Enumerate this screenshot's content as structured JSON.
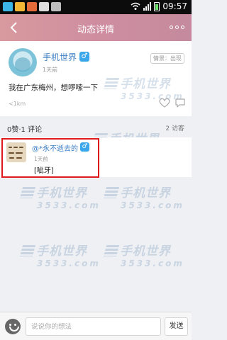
{
  "status_bar": {
    "time": "09:57"
  },
  "header": {
    "title": "动态详情"
  },
  "post": {
    "author": "手机世界",
    "gender_badge": "♂",
    "time": "1天前",
    "mood_tag": "情景：出现",
    "content": "我在广东梅州，想啰嗦一下",
    "distance": "<1km"
  },
  "stats": {
    "likes_comments": "0赞·1 评论",
    "visitors": "2 访客"
  },
  "comment": {
    "author": "@*永不逝去的",
    "gender_badge": "♂",
    "time": "1天前",
    "text": "[呲牙]"
  },
  "watermark": {
    "cn": "手机世界",
    "num": "3533.com"
  },
  "input_bar": {
    "placeholder": "说说你的想法",
    "send_label": "发送"
  },
  "colors": {
    "accent_blue": "#3b7fc4",
    "highlight_red": "#e01a1a",
    "header_gradient": "#d89a9e"
  }
}
